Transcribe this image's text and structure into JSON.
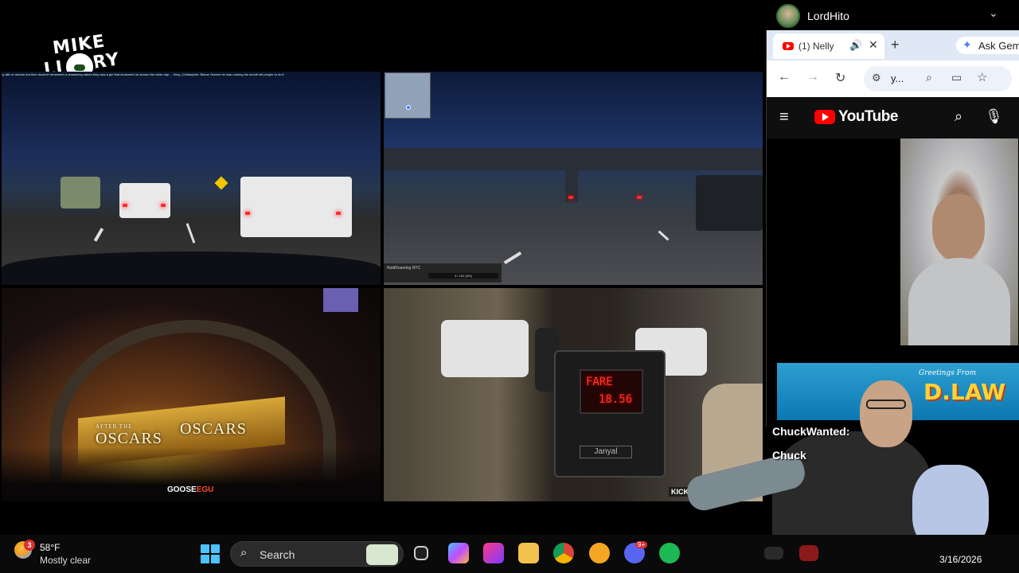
{
  "logo": {
    "text": "MIKE LIAORY"
  },
  "tiles": {
    "top_left": {
      "chat_overlay": "ry still on stream but then docent't remember a showering naked they was a girl that showered on stream the other day ... Sexy_Christopher: Blame Greene he was running his mouth tell people to do it"
    },
    "top_right": {
      "caption_name": "NoldRoaming NYC",
      "caption_progress": "3 / 100 (3%)"
    },
    "bottom_left": {
      "banner_left": "OSCARS",
      "banner_right": "OSCARS",
      "banner_small": "AFTER THE",
      "goose_tag": "GOOSE",
      "goose_suffix": "EGU"
    },
    "bottom_right": {
      "meter_label": "FARE",
      "meter_fare": "18.56",
      "meter_brand": "Janyal",
      "kick_tag": "KICK.COM/DEEPAK"
    }
  },
  "profile": {
    "name": "LordHito",
    "chevron_icon": "chevron-down-icon"
  },
  "browser": {
    "tab": {
      "title": "(1) Nelly",
      "close": "✕"
    },
    "new_tab": "+",
    "gemini_label": "Ask Gem",
    "omnibox_text": "y...",
    "youtube_logo": "YouTube"
  },
  "overlay": {
    "greeting_small": "Greetings From",
    "greeting_big": "D.LAW",
    "chat_lines": [
      {
        "user": "ChuckWanted:"
      },
      {
        "user": "Chuck"
      }
    ]
  },
  "taskbar": {
    "weather_badge": "3",
    "temperature": "58°F",
    "condition": "Mostly clear",
    "search_label": "Search",
    "discord_badge": "9+",
    "date": "3/16/2026",
    "colors": {
      "taskbar_bg": "#0a0a0a",
      "start_accent": "#4cc2ff"
    }
  }
}
